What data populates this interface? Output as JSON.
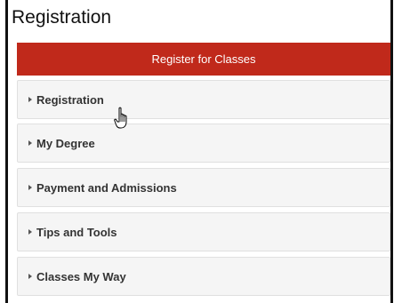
{
  "panel": {
    "title": "Registration"
  },
  "primary_action": {
    "label": "Register for Classes",
    "color": "#c0291b"
  },
  "accordion": {
    "items": [
      {
        "label": "Registration",
        "icon": "caret-right-icon"
      },
      {
        "label": "My Degree",
        "icon": "caret-right-icon"
      },
      {
        "label": "Payment and Admissions",
        "icon": "caret-right-icon"
      },
      {
        "label": "Tips and Tools",
        "icon": "caret-right-icon"
      },
      {
        "label": "Classes My Way",
        "icon": "caret-right-icon"
      }
    ]
  },
  "pointer": {
    "icon": "hand-pointer-cursor-icon"
  }
}
